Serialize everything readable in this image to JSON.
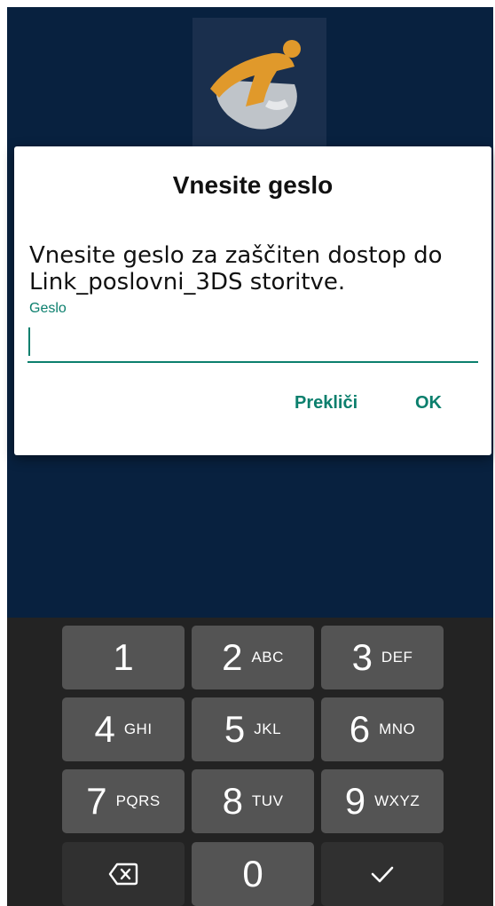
{
  "dialog": {
    "title": "Vnesite geslo",
    "message": "Vnesite geslo za zaščiten dostop do Link_poslovni_3DS storitve.",
    "field_label": "Geslo",
    "field_value": "",
    "cancel_label": "Prekliči",
    "ok_label": "OK"
  },
  "keypad": {
    "keys": [
      {
        "digit": "1",
        "letters": ""
      },
      {
        "digit": "2",
        "letters": "ABC"
      },
      {
        "digit": "3",
        "letters": "DEF"
      },
      {
        "digit": "4",
        "letters": "GHI"
      },
      {
        "digit": "5",
        "letters": "JKL"
      },
      {
        "digit": "6",
        "letters": "MNO"
      },
      {
        "digit": "7",
        "letters": "PQRS"
      },
      {
        "digit": "8",
        "letters": "TUV"
      },
      {
        "digit": "9",
        "letters": "WXYZ"
      },
      {
        "digit": "0",
        "letters": ""
      }
    ],
    "backspace_icon": "backspace-icon",
    "done_icon": "checkmark-icon"
  },
  "colors": {
    "app_background": "#08213f",
    "accent": "#0b7f6d",
    "keyboard_background": "#232323",
    "key": "#545454",
    "key_dark": "#303030",
    "logo_orange": "#e0992b"
  }
}
